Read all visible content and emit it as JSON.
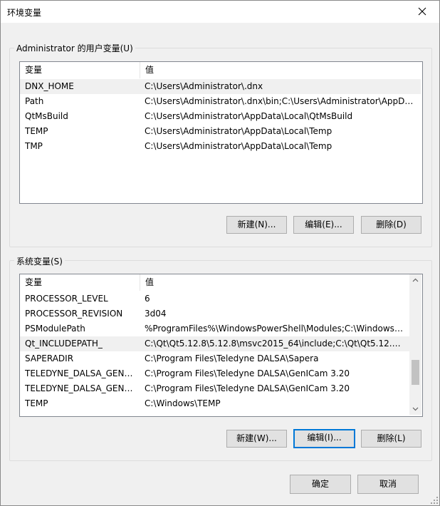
{
  "window": {
    "title": "环境变量"
  },
  "user_section": {
    "label": "Administrator 的用户变量(U)",
    "columns": [
      "变量",
      "值"
    ],
    "rows": [
      {
        "name": "DNX_HOME",
        "value": "C:\\Users\\Administrator\\.dnx"
      },
      {
        "name": "Path",
        "value": "C:\\Users\\Administrator\\.dnx\\bin;C:\\Users\\Administrator\\AppDat..."
      },
      {
        "name": "QtMsBuild",
        "value": "C:\\Users\\Administrator\\AppData\\Local\\QtMsBuild"
      },
      {
        "name": "TEMP",
        "value": "C:\\Users\\Administrator\\AppData\\Local\\Temp"
      },
      {
        "name": "TMP",
        "value": "C:\\Users\\Administrator\\AppData\\Local\\Temp"
      }
    ],
    "selected_index": 0,
    "buttons": {
      "new": "新建(N)...",
      "edit": "编辑(E)...",
      "delete": "删除(D)"
    }
  },
  "system_section": {
    "label": "系统变量(S)",
    "columns": [
      "变量",
      "值"
    ],
    "rows": [
      {
        "name": "PROCESSOR_LEVEL",
        "value": "6"
      },
      {
        "name": "PROCESSOR_REVISION",
        "value": "3d04"
      },
      {
        "name": "PSModulePath",
        "value": "%ProgramFiles%\\WindowsPowerShell\\Modules;C:\\Windows\\..."
      },
      {
        "name": "Qt_INCLUDEPATH_",
        "value": "C:\\Qt\\Qt5.12.8\\5.12.8\\msvc2015_64\\include;C:\\Qt\\Qt5.12.8\\5.1..."
      },
      {
        "name": "SAPERADIR",
        "value": "C:\\Program Files\\Teledyne DALSA\\Sapera"
      },
      {
        "name": "TELEDYNE_DALSA_GENIC...",
        "value": "C:\\Program Files\\Teledyne DALSA\\GenICam 3.20"
      },
      {
        "name": "TELEDYNE_DALSA_GENIC...",
        "value": "C:\\Program Files\\Teledyne DALSA\\GenICam 3.20"
      },
      {
        "name": "TEMP",
        "value": "C:\\Windows\\TEMP"
      }
    ],
    "selected_index": 3,
    "buttons": {
      "new": "新建(W)...",
      "edit": "编辑(I)...",
      "delete": "删除(L)"
    }
  },
  "footer": {
    "ok": "确定",
    "cancel": "取消"
  },
  "colors": {
    "focus_border": "#0078d7",
    "selection": "#f0f0f0",
    "button_face": "#e1e1e1"
  }
}
